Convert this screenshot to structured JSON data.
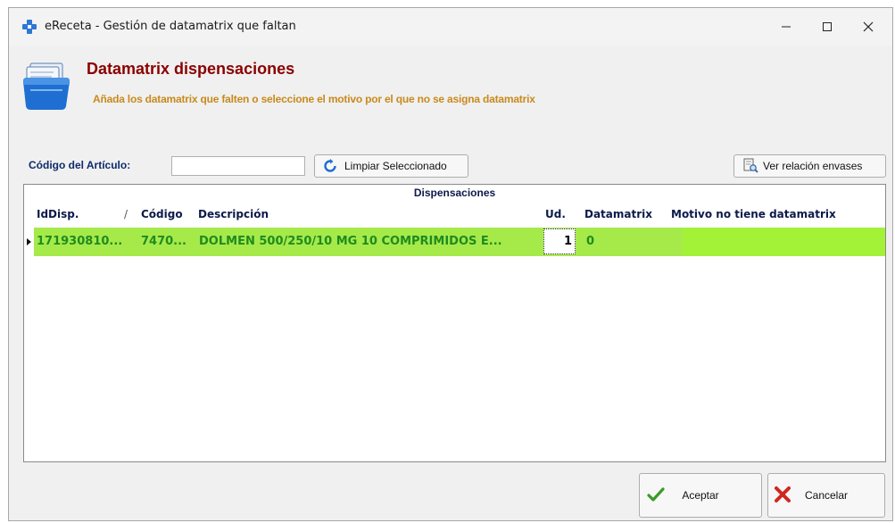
{
  "window": {
    "title": "eReceta - Gestión de datamatrix que faltan",
    "controls": [
      "minimize",
      "maximize",
      "close"
    ]
  },
  "header": {
    "title": "Datamatrix dispensaciones",
    "subtitle": "Añada los datamatrix que falten o seleccione el motivo por el que no se asigna datamatrix"
  },
  "filter": {
    "code_label": "Código del Artículo:",
    "code_value": "",
    "clear_button": "Limpiar Seleccionado",
    "relation_button": "Ver relación envases"
  },
  "grid": {
    "band_title": "Dispensaciones",
    "columns": [
      "IdDisp.",
      "Código",
      "Descripción",
      "Ud.",
      "Datamatrix",
      "Motivo no tiene datamatrix"
    ],
    "sort_indicator": "/",
    "rows": [
      {
        "id": "171930810...",
        "code": "7470...",
        "description": "DOLMEN 500/250/10 MG 10 COMPRIMIDOS E...",
        "ud": "1",
        "datamatrix": "0",
        "reason": ""
      }
    ]
  },
  "footer": {
    "accept_button": "Aceptar",
    "cancel_button": "Cancelar"
  },
  "colors": {
    "title": "#8b0000",
    "subtitle": "#c88a1c",
    "row_highlight": "#a6ea4a",
    "row_text": "#1f8b1f",
    "header_text": "#0d1a4a"
  }
}
